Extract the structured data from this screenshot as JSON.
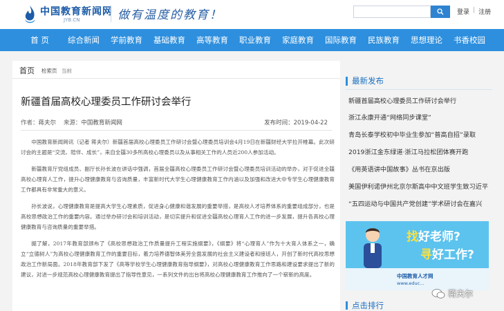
{
  "header": {
    "logo_text": "中国教育新闻网",
    "logo_url": "JYB.CN",
    "slogan": "做有温度的教育！",
    "login": "登录",
    "sep": "|",
    "register": "注册"
  },
  "nav": [
    "首 页",
    "综合新闻",
    "学前教育",
    "基础教育",
    "高等教育",
    "职业教育",
    "家庭教育",
    "国际教育",
    "民族教育",
    "思想理论",
    "书香校园"
  ],
  "breadcrumb": {
    "home": "首页",
    "level1": "检索页",
    "level2": "当前"
  },
  "article": {
    "title": "新疆首届高校心理委员工作研讨会举行",
    "author_label": "作者：",
    "author": "蒋夫尔",
    "source_label": "来源：",
    "source": "中国教育新闻网",
    "date_label": "发布时间：",
    "date": "2019-04-22",
    "paragraphs": [
      "中国教育新闻网讯（记者 蒋夫尔）新疆首届高校心理委员工作研讨会暨心理委员培训会4月19日在新疆财经大学拉开帷幕。此次研讨会的主题是“交流、陪伴、成长”，来自全疆30多所高校心理委员以及从事相关工作的人员近200人参加活动。",
      "新疆教育厅党组成员、副厅长孙长波在讲话中强调，首届全疆高校心理委员工作研讨会暨心理委员培训活动的举办，对于促进全疆高校心理育人工作，提升心理健康教育与咨询质量，丰富新时代大学生心理健康教育工作内涵以及加强和改进大中专学生心理健康教育工作都具有非常重大的意义。",
      "孙长波说，心理健康教育是提高大学生心理素质，促进身心健康和谐发展的重要举措，是高校人才培养体系的重要组成部分，也是高校思想政治工作的重要内容。通过举办研讨会和培训活动，是切实提升和促进全疆高校心理育人工作的进一步发展，提升各高校心理健康教育与咨询质量的重要举措。",
      "据了解，2017年教育部颁布了《高校思想政治工作质量提升工程实施纲要》，《纲要》将“心理育人”作为十大育人体系之一，确立“立德树人”为高校心理健康教育工作的重要目标，着力培养德智体美劳全面发展的社会主义建设者和接班人，开创了新时代高校思想政治工作新局面。2018年教育部下发了《高等学校学生心理健康教育指导纲要》，对高校心理健康教育工作思路和建设要求提出了新的建议，对进一步规范高校心理健康教育提出了指导性意见，一系列文件的出台将高校心理健康教育工作推向了一个崭新的高度。"
    ]
  },
  "sidebar": {
    "latest_title": "最新发布",
    "latest": [
      "新疆首届高校心理委员工作研讨会举行",
      "浙江永康开通“网络同步课堂”",
      "青岛长泰学校初中毕业生参加“普高自招”录取",
      "2019浙江金东绿道·浙江马拉松团体赛开跑",
      "《用英语讲中国故事》丛书在京出版",
      "美国伊利诺伊州北京尔斯高中中文班学生致习近平",
      "“五四运动与中国共产党创建”学术研讨会在嘉兴"
    ],
    "ad": {
      "line1_a": "找",
      "line1_b": "好老师?",
      "line2_a": "寻",
      "line2_b": "好工作?",
      "brand": "中国教育人才网",
      "url": "www.educ..."
    },
    "popular_title": "点击排行"
  },
  "watermark": "蒋夫尔",
  "colors": {
    "nav": "#2d8fde",
    "brand": "#1c5ca8",
    "accent": "#1c6fc0",
    "ad": "#5cc3ee"
  }
}
